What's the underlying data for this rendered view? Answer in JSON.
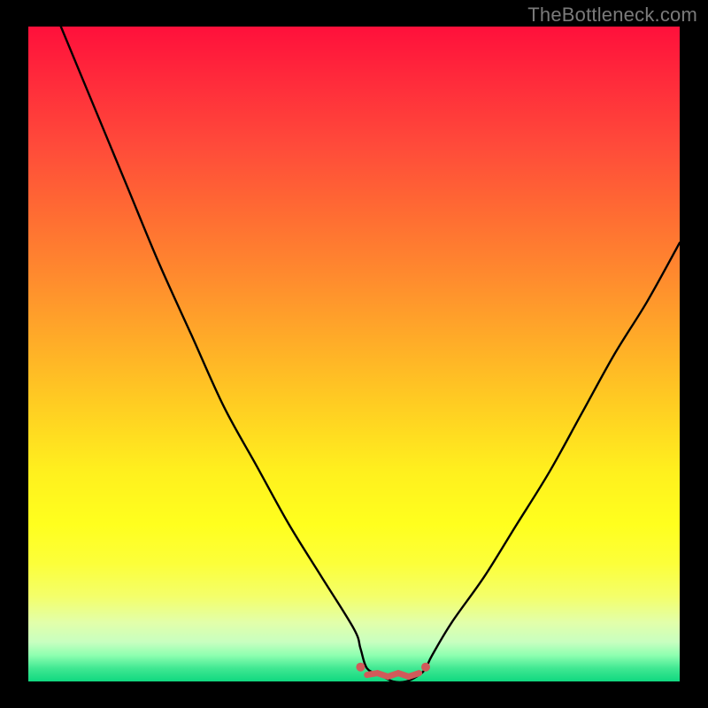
{
  "watermark": {
    "text": "TheBottleneck.com"
  },
  "colors": {
    "page_bg": "#000000",
    "curve_stroke": "#000000",
    "marker_stroke": "#d15a5a",
    "marker_fill": "#d15a5a",
    "watermark": "#7a7a7a",
    "gradient_top": "#ff103b",
    "gradient_bottom": "#10d880"
  },
  "chart_data": {
    "type": "line",
    "title": "",
    "xlabel": "",
    "ylabel": "",
    "xlim": [
      0,
      100
    ],
    "ylim": [
      0,
      100
    ],
    "grid": false,
    "legend": false,
    "series": [
      {
        "name": "bottleneck-curve",
        "x": [
          5,
          10,
          15,
          20,
          25,
          30,
          35,
          40,
          45,
          50,
          51,
          52,
          54,
          56,
          58,
          60,
          61,
          62,
          65,
          70,
          75,
          80,
          85,
          90,
          95,
          100
        ],
        "values": [
          100,
          88,
          76,
          64,
          53,
          42,
          33,
          24,
          16,
          8,
          5,
          2,
          1,
          0,
          0,
          1,
          2,
          4,
          9,
          16,
          24,
          32,
          41,
          50,
          58,
          67
        ]
      }
    ],
    "annotations": [
      {
        "name": "bottom-marker-left-dot",
        "type": "point",
        "x": 51,
        "y": 2.2,
        "color": "#d15a5a"
      },
      {
        "name": "bottom-marker-right-dot",
        "type": "point",
        "x": 61,
        "y": 2.2,
        "color": "#d15a5a"
      },
      {
        "name": "bottom-marker-segment",
        "type": "segment",
        "x1": 52,
        "y1": 1.0,
        "x2": 60,
        "y2": 1.0,
        "color": "#d15a5a"
      }
    ],
    "background_gradient": {
      "direction": "vertical",
      "stops": [
        {
          "pos": 0.0,
          "color": "#ff103b"
        },
        {
          "pos": 0.5,
          "color": "#ffb426"
        },
        {
          "pos": 0.78,
          "color": "#ffff1e"
        },
        {
          "pos": 1.0,
          "color": "#10d880"
        }
      ]
    }
  }
}
